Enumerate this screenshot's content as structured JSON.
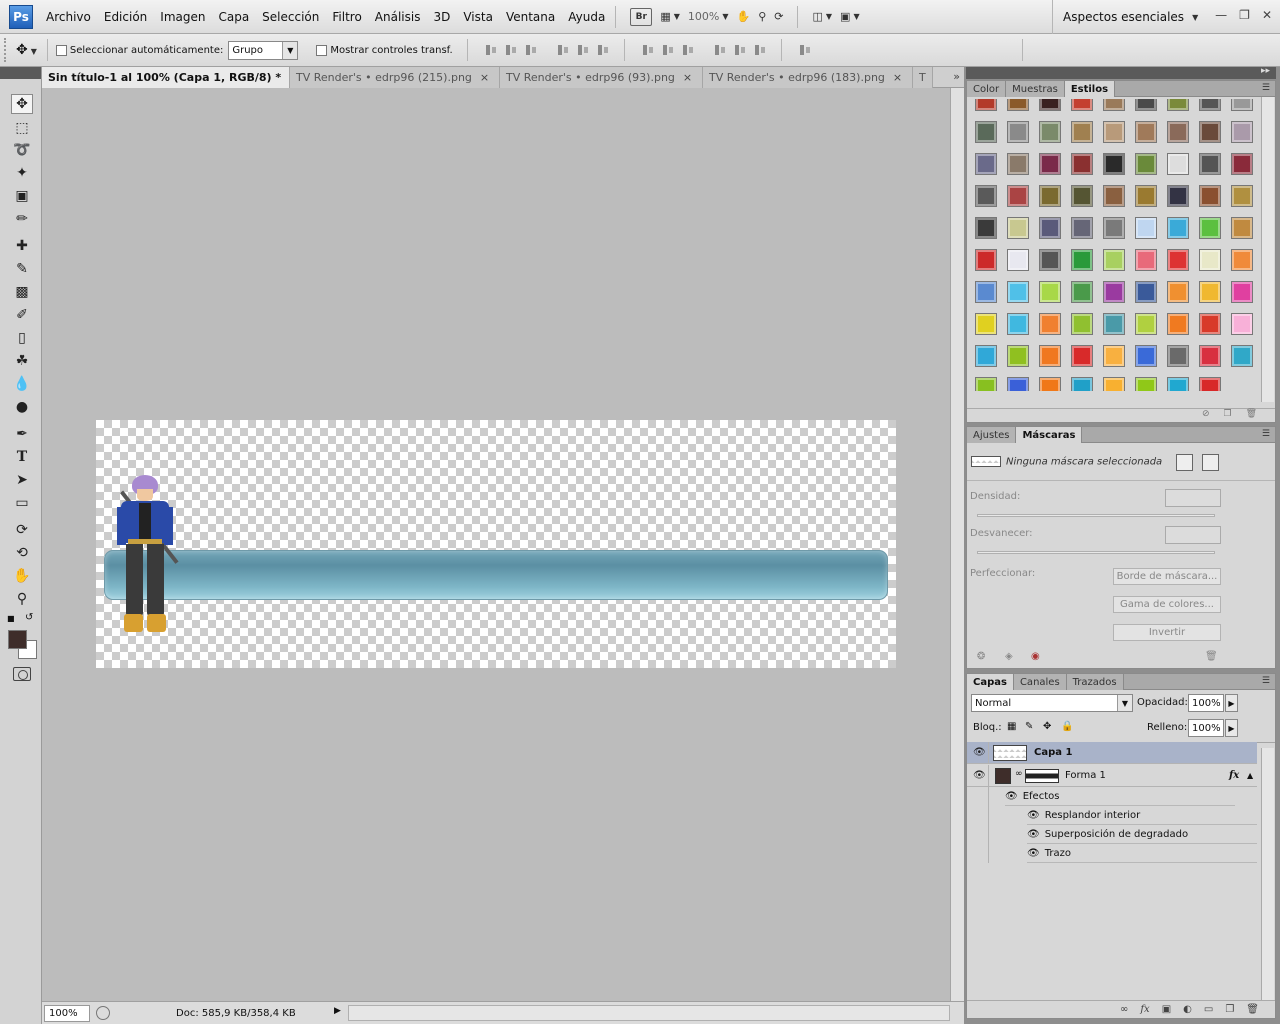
{
  "app": {
    "logo_text": "Ps",
    "workspace": "Aspectos esenciales"
  },
  "menu": [
    "Archivo",
    "Edición",
    "Imagen",
    "Capa",
    "Selección",
    "Filtro",
    "Análisis",
    "3D",
    "Vista",
    "Ventana",
    "Ayuda"
  ],
  "menubar_extras": {
    "bridge_label": "Br",
    "zoom": "100%"
  },
  "options": {
    "auto_select_label": "Seleccionar automáticamente:",
    "auto_select_value": "Grupo",
    "transform_controls_label": "Mostrar controles transf."
  },
  "doc_tabs": [
    {
      "label": "Sin título-1 al 100% (Capa 1, RGB/8) *",
      "close": "×"
    },
    {
      "label": "TV Render's • edrp96 (215).png",
      "close": "×"
    },
    {
      "label": "TV Render's • edrp96 (93).png",
      "close": "×"
    },
    {
      "label": "TV Render's • edrp96 (183).png",
      "close": "×"
    },
    {
      "label": "T",
      "close": ""
    }
  ],
  "tabs_more": "»",
  "status": {
    "zoom": "100%",
    "doc_info": "Doc: 585,9 KB/358,4 KB"
  },
  "styles_panel": {
    "tabs": [
      "Color",
      "Muestras",
      "Estilos"
    ],
    "active_tab": 2,
    "swatch_colors": [
      "#b33a2a",
      "#8a5a2a",
      "#3a2020",
      "#c44030",
      "#9a7a5a",
      "#4a4a4a",
      "#7a8a3a",
      "#555555",
      "#999999",
      "#5a6a5a",
      "#8a8a8a",
      "#7a8a6a",
      "#a08050",
      "#b89a7a",
      "#a07a5a",
      "#8a6a5a",
      "#6a4a3a",
      "#aa9aaa",
      "#6a6a8a",
      "#8a7a6a",
      "#7a2a4a",
      "#8a3030",
      "#2a2a2a",
      "#6a8a3a",
      "#dddddd",
      "#555555",
      "#8a2a3a",
      "#5a5a5a",
      "#aa4444",
      "#7a6a30",
      "#555533",
      "#8a6040",
      "#9a7a30",
      "#333344",
      "#8a5030",
      "#b09040",
      "#3a3a3a",
      "#c8c890",
      "#5a5a7a",
      "#666677",
      "#7a7a7a",
      "#bfd6f0",
      "#3aaad8",
      "#5cc040",
      "#c08a40",
      "#cc2a2a",
      "#e8e8f0",
      "#555555",
      "#2a9a3a",
      "#a8d060",
      "#e86a7a",
      "#dd3333",
      "#e8e8c8",
      "#f08a3a",
      "#5a8ad0",
      "#50c0e8",
      "#a8d848",
      "#4a9a4a",
      "#9a3aa0",
      "#3a5a9a",
      "#f09030",
      "#f0b830",
      "#e040a0",
      "#e0d020",
      "#40b8e0",
      "#f08030",
      "#90c030",
      "#4a9aa8",
      "#b0d040",
      "#f07a20",
      "#d83a2a",
      "#f8b0d8",
      "#30a8d8",
      "#90c020",
      "#f07820",
      "#d82a2a",
      "#f8b040",
      "#3a6ad8",
      "#6a6a6a",
      "#d83040",
      "#30a8c8",
      "#88c020",
      "#3a60d8",
      "#f07818",
      "#20a0c8",
      "#f8b030",
      "#90c818",
      "#20a8d0",
      "#d82828"
    ]
  },
  "masks_panel": {
    "tabs": [
      "Ajustes",
      "Máscaras"
    ],
    "active_tab": 1,
    "no_mask": "Ninguna máscara seleccionada",
    "density_label": "Densidad:",
    "feather_label": "Desvanecer:",
    "refine_label": "Perfeccionar:",
    "edge_button": "Borde de máscara...",
    "color_range_button": "Gama de colores...",
    "invert_button": "Invertir"
  },
  "layers_panel": {
    "tabs": [
      "Capas",
      "Canales",
      "Trazados"
    ],
    "active_tab": 0,
    "blend_mode": "Normal",
    "opacity_label": "Opacidad:",
    "opacity_value": "100%",
    "lock_label": "Bloq.:",
    "fill_label": "Relleno:",
    "fill_value": "100%",
    "layers": [
      {
        "name": "Capa 1",
        "selected": true
      },
      {
        "name": "Forma 1",
        "selected": false,
        "fx": "fx"
      }
    ],
    "effects_label": "Efectos",
    "effects": [
      "Resplandor interior",
      "Superposición de degradado",
      "Trazo"
    ]
  },
  "colors": {
    "foreground": "#3e2d2a",
    "background": "#ffffff",
    "bar_gradient_top": "#73a6b8",
    "bar_gradient_bottom": "#9fd1df"
  }
}
